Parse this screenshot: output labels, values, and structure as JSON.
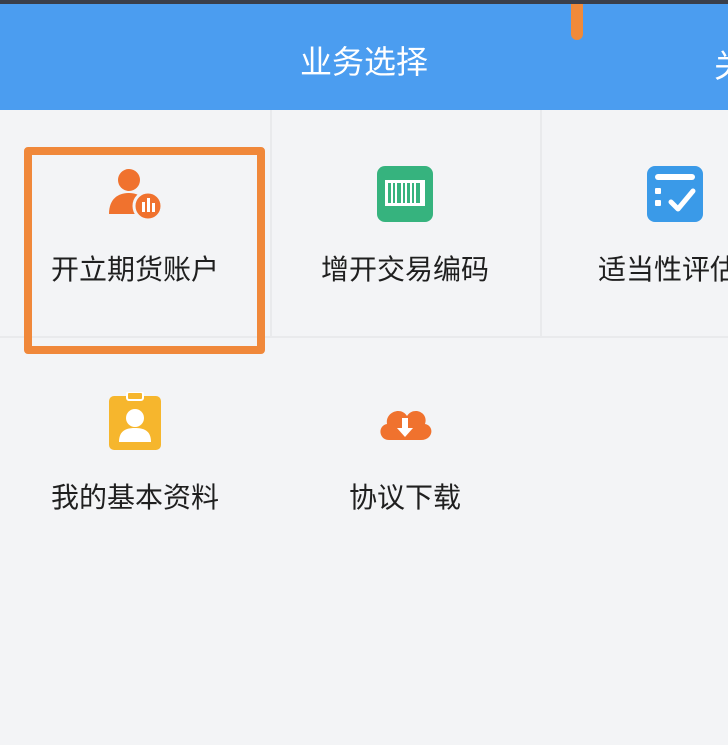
{
  "header": {
    "title": "业务选择",
    "right_partial": "关"
  },
  "grid": {
    "items": [
      {
        "label": "开立期货账户",
        "icon": "user-account-icon",
        "color": "#f0722e"
      },
      {
        "label": "增开交易编码",
        "icon": "barcode-icon",
        "color": "#36b37e"
      },
      {
        "label": "适当性评估",
        "icon": "checklist-icon",
        "color": "#3a9ae8"
      },
      {
        "label": "我的基本资料",
        "icon": "id-badge-icon",
        "color": "#f6b62d"
      },
      {
        "label": "协议下载",
        "icon": "cloud-download-icon",
        "color": "#f0722e"
      }
    ]
  },
  "colors": {
    "header_bg": "#4b9df0",
    "highlight": "#f0883a"
  }
}
